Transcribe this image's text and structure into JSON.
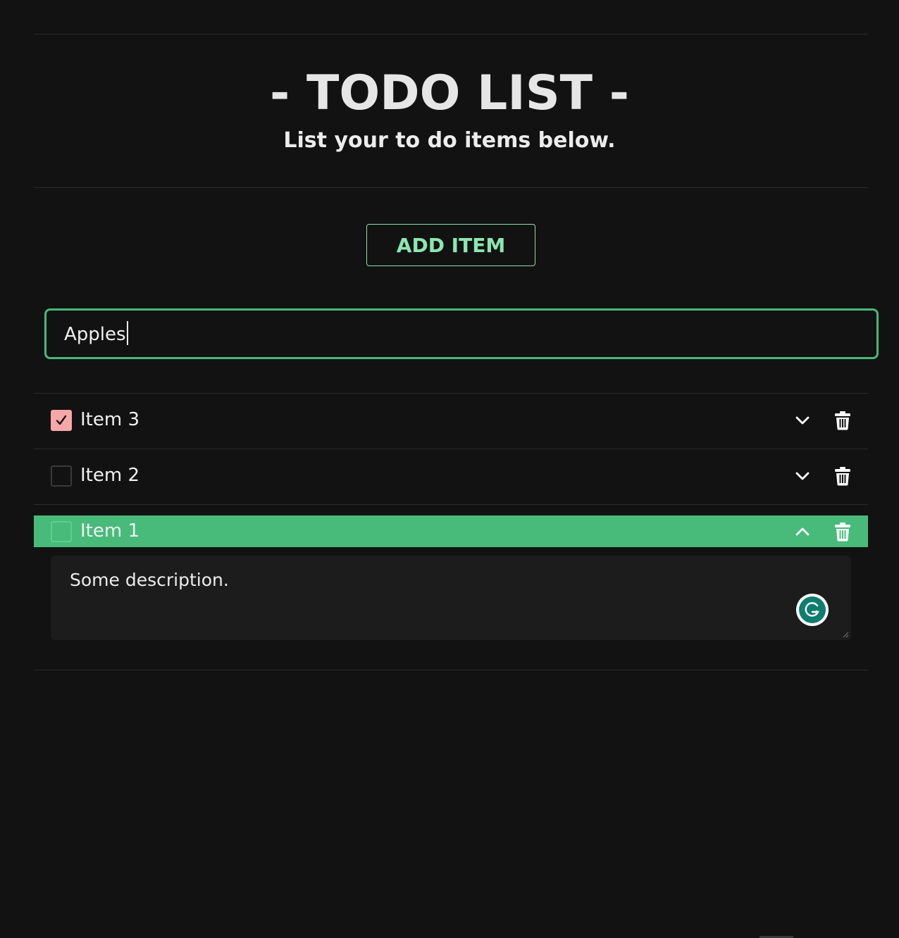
{
  "header": {
    "title": "- TODO LIST -",
    "subtitle": "List your to do items below."
  },
  "add_button": {
    "label": "ADD ITEM"
  },
  "new_item_input": {
    "value": "Apples"
  },
  "todos": [
    {
      "label": "Item 3",
      "checked": true,
      "expanded": false,
      "toggle_icon": "chevron-down-icon"
    },
    {
      "label": "Item 2",
      "checked": false,
      "expanded": false,
      "toggle_icon": "chevron-down-icon"
    },
    {
      "label": "Item 1",
      "checked": false,
      "expanded": true,
      "toggle_icon": "chevron-up-icon",
      "description": "Some description."
    }
  ],
  "colors": {
    "background": "#121212",
    "accent_green": "#48bb7b",
    "button_text": "#8ce6b0",
    "checked_box": "#f6a8a8"
  },
  "icons": {
    "delete": "trash-icon",
    "assistant": "grammarly-icon"
  }
}
